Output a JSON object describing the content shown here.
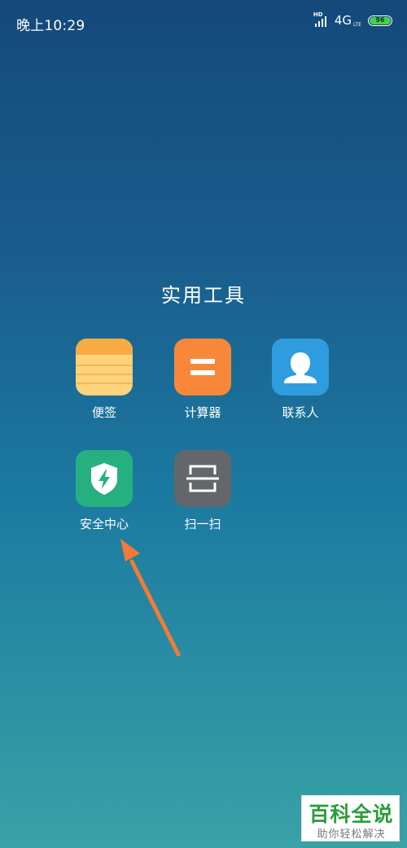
{
  "status_bar": {
    "time": "晚上10:29",
    "hd_label": "HD",
    "network": "4G",
    "network_sub": "LTE",
    "battery_level": "96"
  },
  "folder": {
    "title": "实用工具",
    "apps": [
      {
        "label": "便签",
        "icon": "notes-icon",
        "color": "#fed37b"
      },
      {
        "label": "计算器",
        "icon": "calculator-icon",
        "color": "#f9873a"
      },
      {
        "label": "联系人",
        "icon": "contacts-icon",
        "color": "#2f9cdf"
      },
      {
        "label": "安全中心",
        "icon": "security-shield-icon",
        "color": "#27b07f"
      },
      {
        "label": "扫一扫",
        "icon": "scan-icon",
        "color": "#63676b"
      }
    ]
  },
  "annotation": {
    "arrow_color": "#f47a35"
  },
  "watermark": {
    "title": "百科全说",
    "subtitle": "助你轻松解决"
  }
}
